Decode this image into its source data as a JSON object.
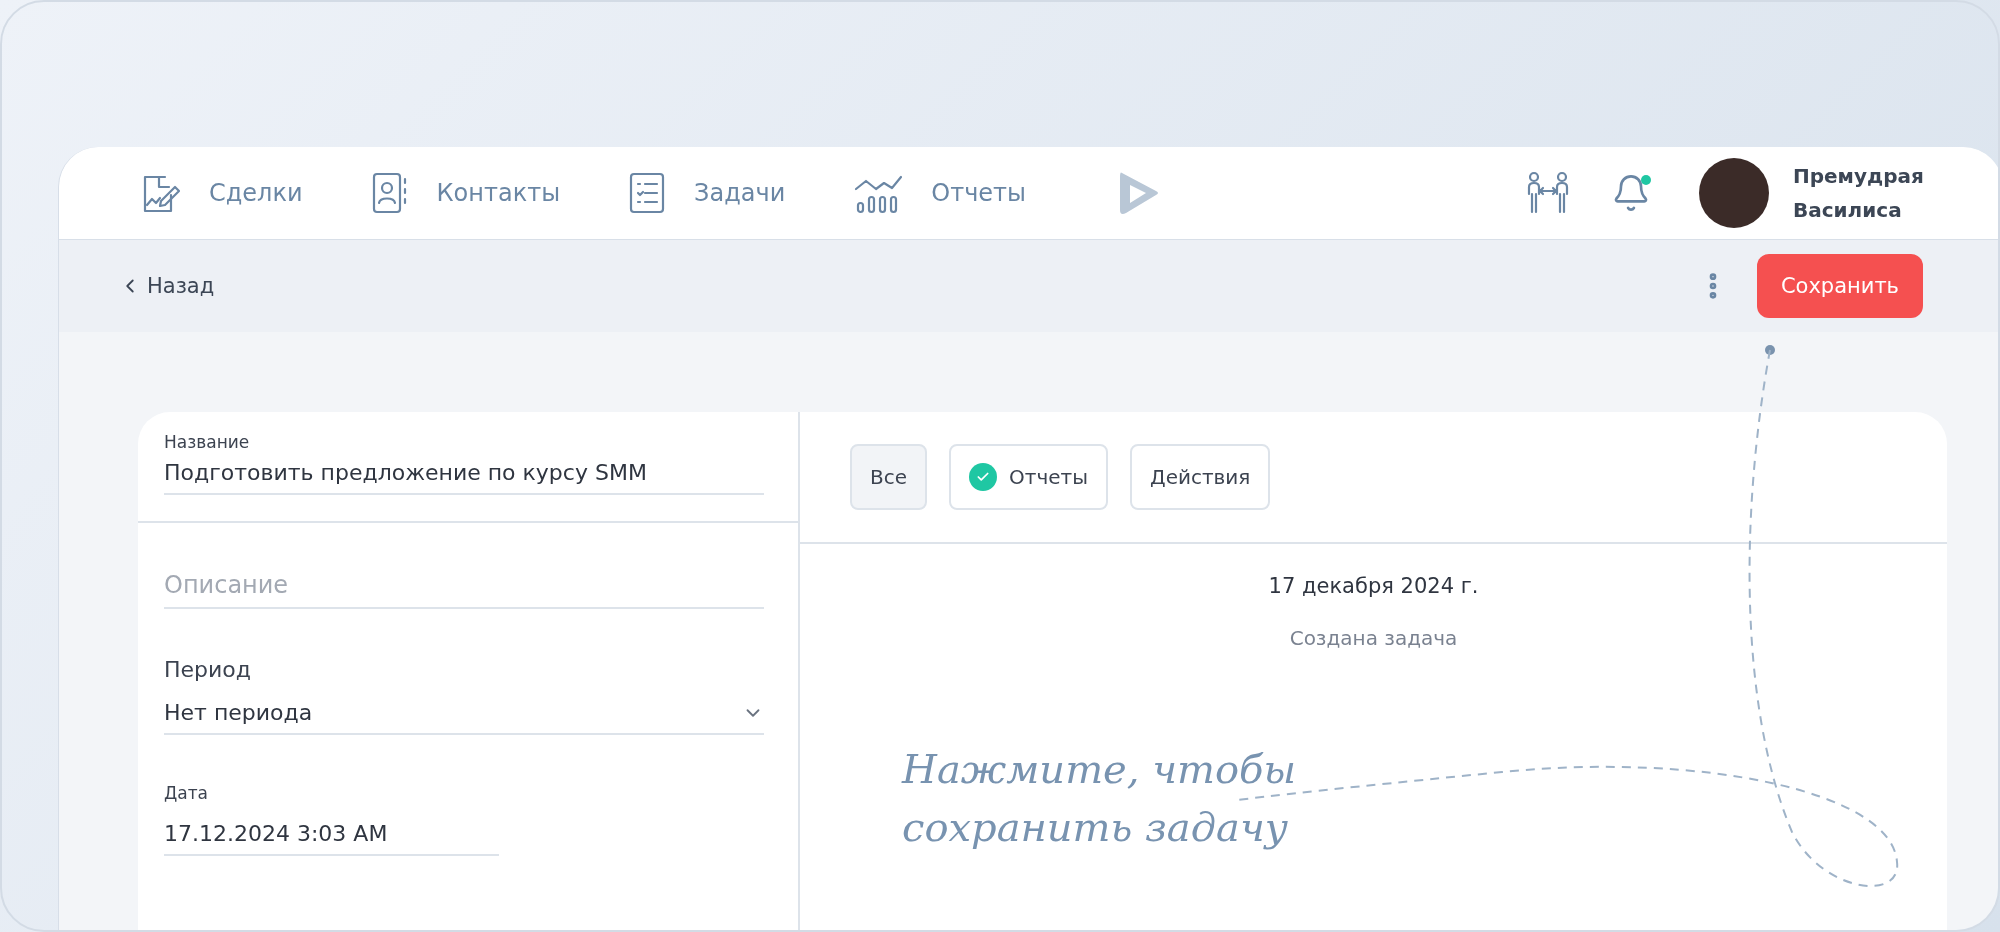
{
  "nav": {
    "items": [
      {
        "label": "Сделки"
      },
      {
        "label": "Контакты"
      },
      {
        "label": "Задачи"
      },
      {
        "label": "Отчеты"
      }
    ]
  },
  "notifications": {
    "unread": true
  },
  "user": {
    "name": "Премудрая Василиса"
  },
  "toolbar": {
    "back": "Назад",
    "save": "Сохранить"
  },
  "form": {
    "fields": [
      {
        "kind": "text",
        "label": "Название",
        "value": "Подготовить предложение по курсу SMM"
      },
      {
        "kind": "text",
        "placeholder": "Описание"
      },
      {
        "kind": "select",
        "label": "Период",
        "value": "Нет периода"
      },
      {
        "kind": "date",
        "label": "Дата",
        "value": "17.12.2024 3:03 AM"
      }
    ]
  },
  "filters": [
    {
      "label": "Все",
      "selected": true,
      "kind": "plain"
    },
    {
      "label": "Отчеты",
      "selected": false,
      "kind": "icon"
    },
    {
      "label": "Действия",
      "selected": false,
      "kind": "plain"
    }
  ],
  "timeline": {
    "date": "17 декабря 2024 г.",
    "events": [
      "Создана задача"
    ]
  },
  "annotation": {
    "lines": [
      "Нажмите, чтобы",
      "сохранить задачу"
    ]
  }
}
